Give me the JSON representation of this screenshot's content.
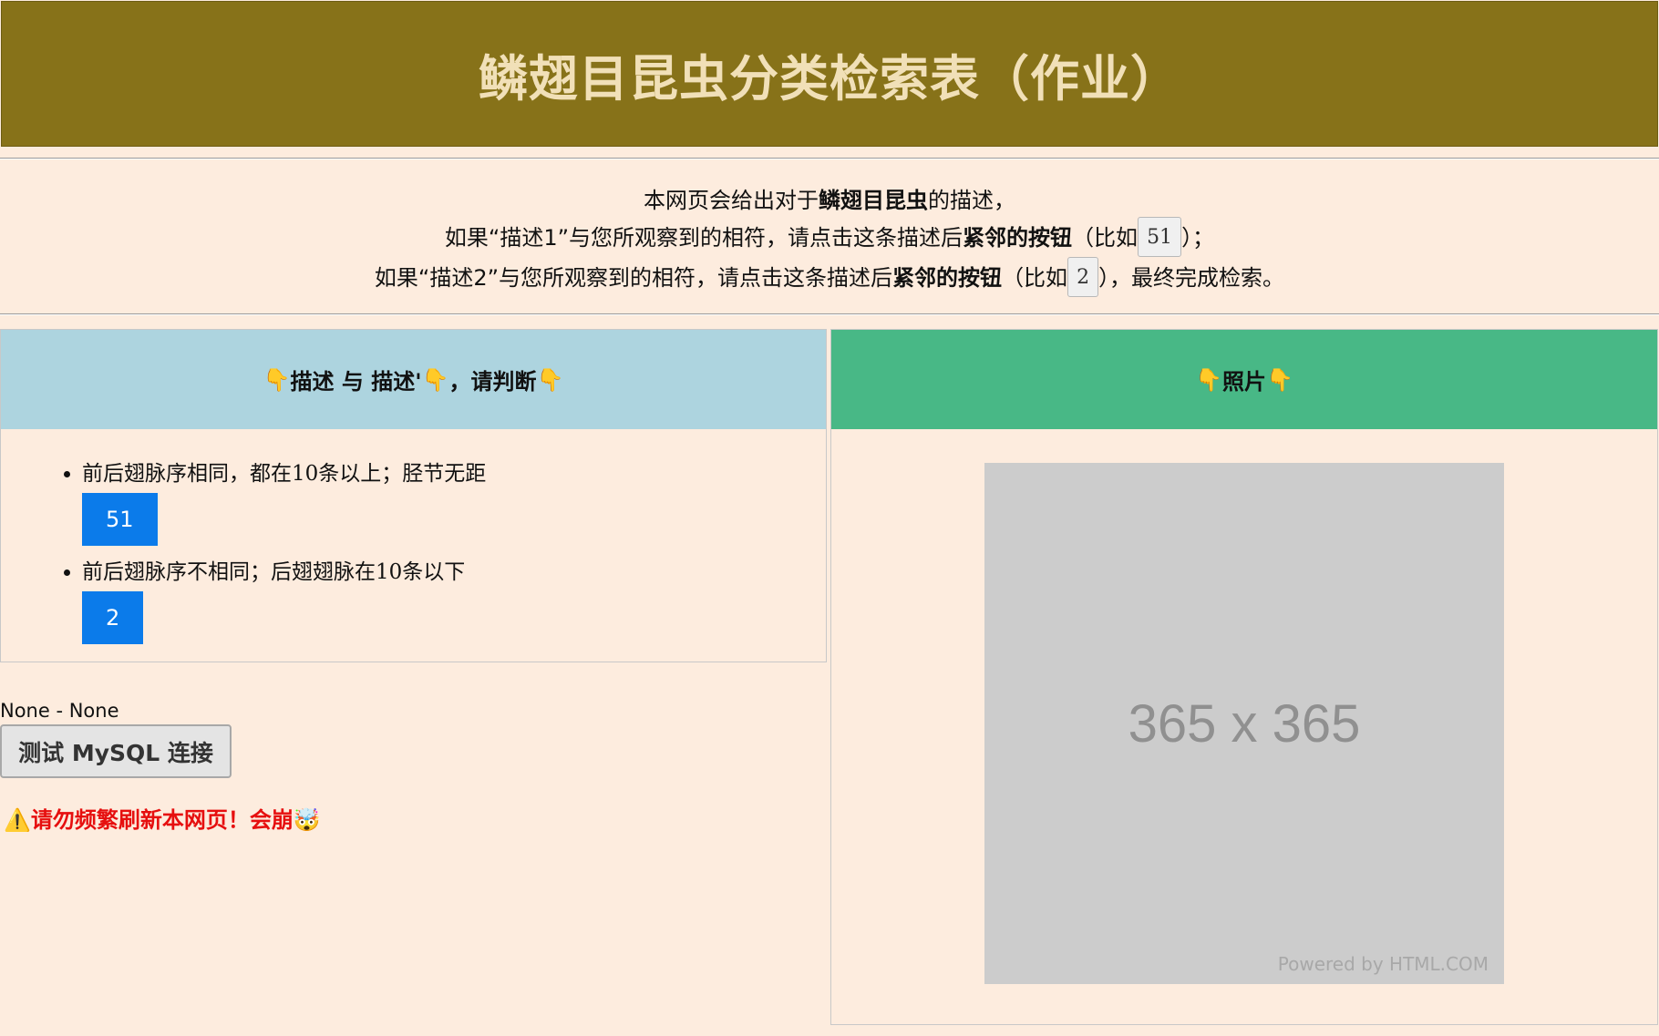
{
  "header": {
    "title": "鳞翅目昆虫分类检索表（作业）"
  },
  "intro": {
    "line1_pre": "本网页会给出对于",
    "line1_bold": "鳞翅目昆虫",
    "line1_post": "的描述，",
    "line2_pre": "如果“描述1”与您所观察到的相符，请点击这条描述后",
    "line2_bold": "紧邻的按钮",
    "line2_mid": "（比如",
    "line2_example": "51",
    "line2_post": "）；",
    "line3_pre": "如果“描述2”与您所观察到的相符，请点击这条描述后",
    "line3_bold": "紧邻的按钮",
    "line3_mid": "（比如",
    "line3_example": "2",
    "line3_post": "），最终完成检索。"
  },
  "left_panel": {
    "heading_icon_left": "👇",
    "heading_text": "描述 与 描述'",
    "heading_icon_mid": "👇",
    "heading_text2": "，请判断",
    "heading_icon_right": "👇",
    "items": [
      {
        "text": "前后翅脉序相同，都在10条以上；胫节无距",
        "button": "51"
      },
      {
        "text": "前后翅脉序不相同；后翅翅脉在10条以下",
        "button": "2"
      }
    ]
  },
  "right_panel": {
    "heading_icon_left": "👇",
    "heading_text": "照片",
    "heading_icon_right": "👇",
    "photo_size_text": "365 x 365",
    "photo_credit": "Powered by HTML.COM"
  },
  "db_status": "None - None",
  "mysql_button": "测试 MySQL 连接",
  "warning": {
    "icon": "⚠️",
    "text": "请勿频繁刷新本网页！会崩",
    "icon_end": "🤯"
  }
}
